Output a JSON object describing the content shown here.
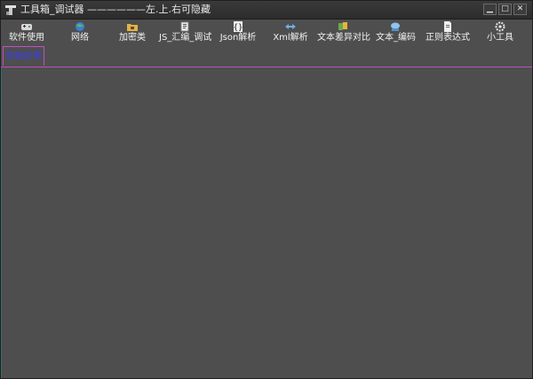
{
  "window": {
    "title": "工具箱_调试器 ——————左.上.右可隐藏",
    "controls": {
      "minimize": "▁",
      "maximize": "□",
      "close": "✕"
    }
  },
  "toolbar": {
    "items": [
      {
        "label": "软件使用",
        "icon": "gamepad-icon"
      },
      {
        "label": "网络",
        "icon": "globe-icon"
      },
      {
        "label": "加密类",
        "icon": "folder-lock-icon"
      },
      {
        "label": "JS_汇编_调试",
        "icon": "script-icon"
      },
      {
        "label": "Json解析",
        "icon": "braces-icon"
      },
      {
        "label": "Xml解析",
        "icon": "xml-arrows-icon"
      },
      {
        "label": "文本差异对比",
        "icon": "compare-icon"
      },
      {
        "label": "文本_编码",
        "icon": "encode-icon"
      },
      {
        "label": "正则表达式",
        "icon": "document-icon"
      },
      {
        "label": "小工具",
        "icon": "gear-icon"
      }
    ]
  },
  "tabs": [
    {
      "label": "初始应用",
      "active": true
    }
  ],
  "colors": {
    "background": "#4e4e4e",
    "tab_border": "#c050c8",
    "tab_text": "#3b3bff"
  }
}
